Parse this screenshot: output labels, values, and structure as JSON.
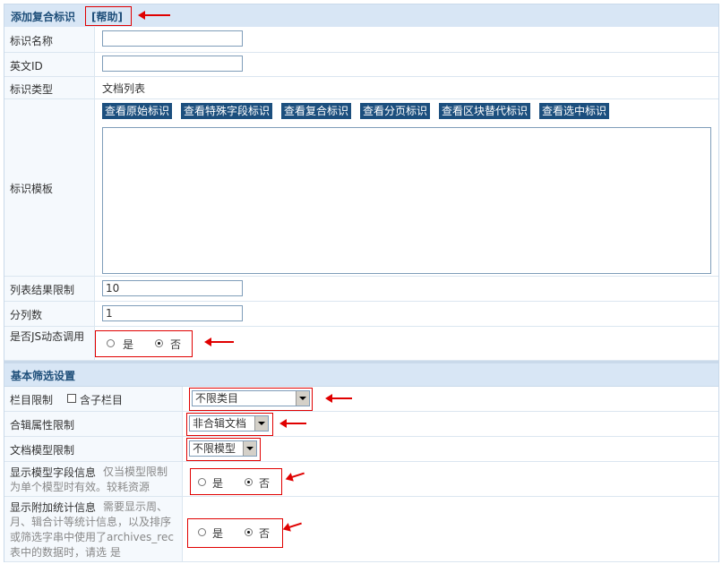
{
  "section1": {
    "title": "添加复合标识",
    "help_link": "[帮助]"
  },
  "fields": {
    "tag_name_label": "标识名称",
    "english_id_label": "英文ID",
    "tag_type_label": "标识类型",
    "tag_type_value": "文档列表",
    "tag_template_label": "标识模板",
    "list_limit_label": "列表结果限制",
    "list_limit_value": "10",
    "columns_label": "分列数",
    "columns_value": "1",
    "js_dynamic_label": "是否JS动态调用",
    "js_yes": "是",
    "js_no": "否"
  },
  "template_buttons": [
    "查看原始标识",
    "查看特殊字段标识",
    "查看复合标识",
    "查看分页标识",
    "查看区块替代标识",
    "查看选中标识"
  ],
  "section2": {
    "title": "基本筛选设置"
  },
  "filters": {
    "category_label": "栏目限制",
    "include_sub_label": "含子栏目",
    "category_select": "不限类目",
    "album_label": "合辑属性限制",
    "album_select": "非合辑文档",
    "model_label": "文档模型限制",
    "model_select": "不限模型",
    "show_model_fields_label": "显示模型字段信息",
    "show_model_fields_note": "仅当模型限制为单个模型时有效。较耗资源",
    "show_stats_label": "显示附加统计信息",
    "show_stats_note": "需要显示周、月、辑合计等统计信息，以及排序或筛选字串中使用了archives_rec表中的数据时，请选 是",
    "yes": "是",
    "no": "否"
  }
}
